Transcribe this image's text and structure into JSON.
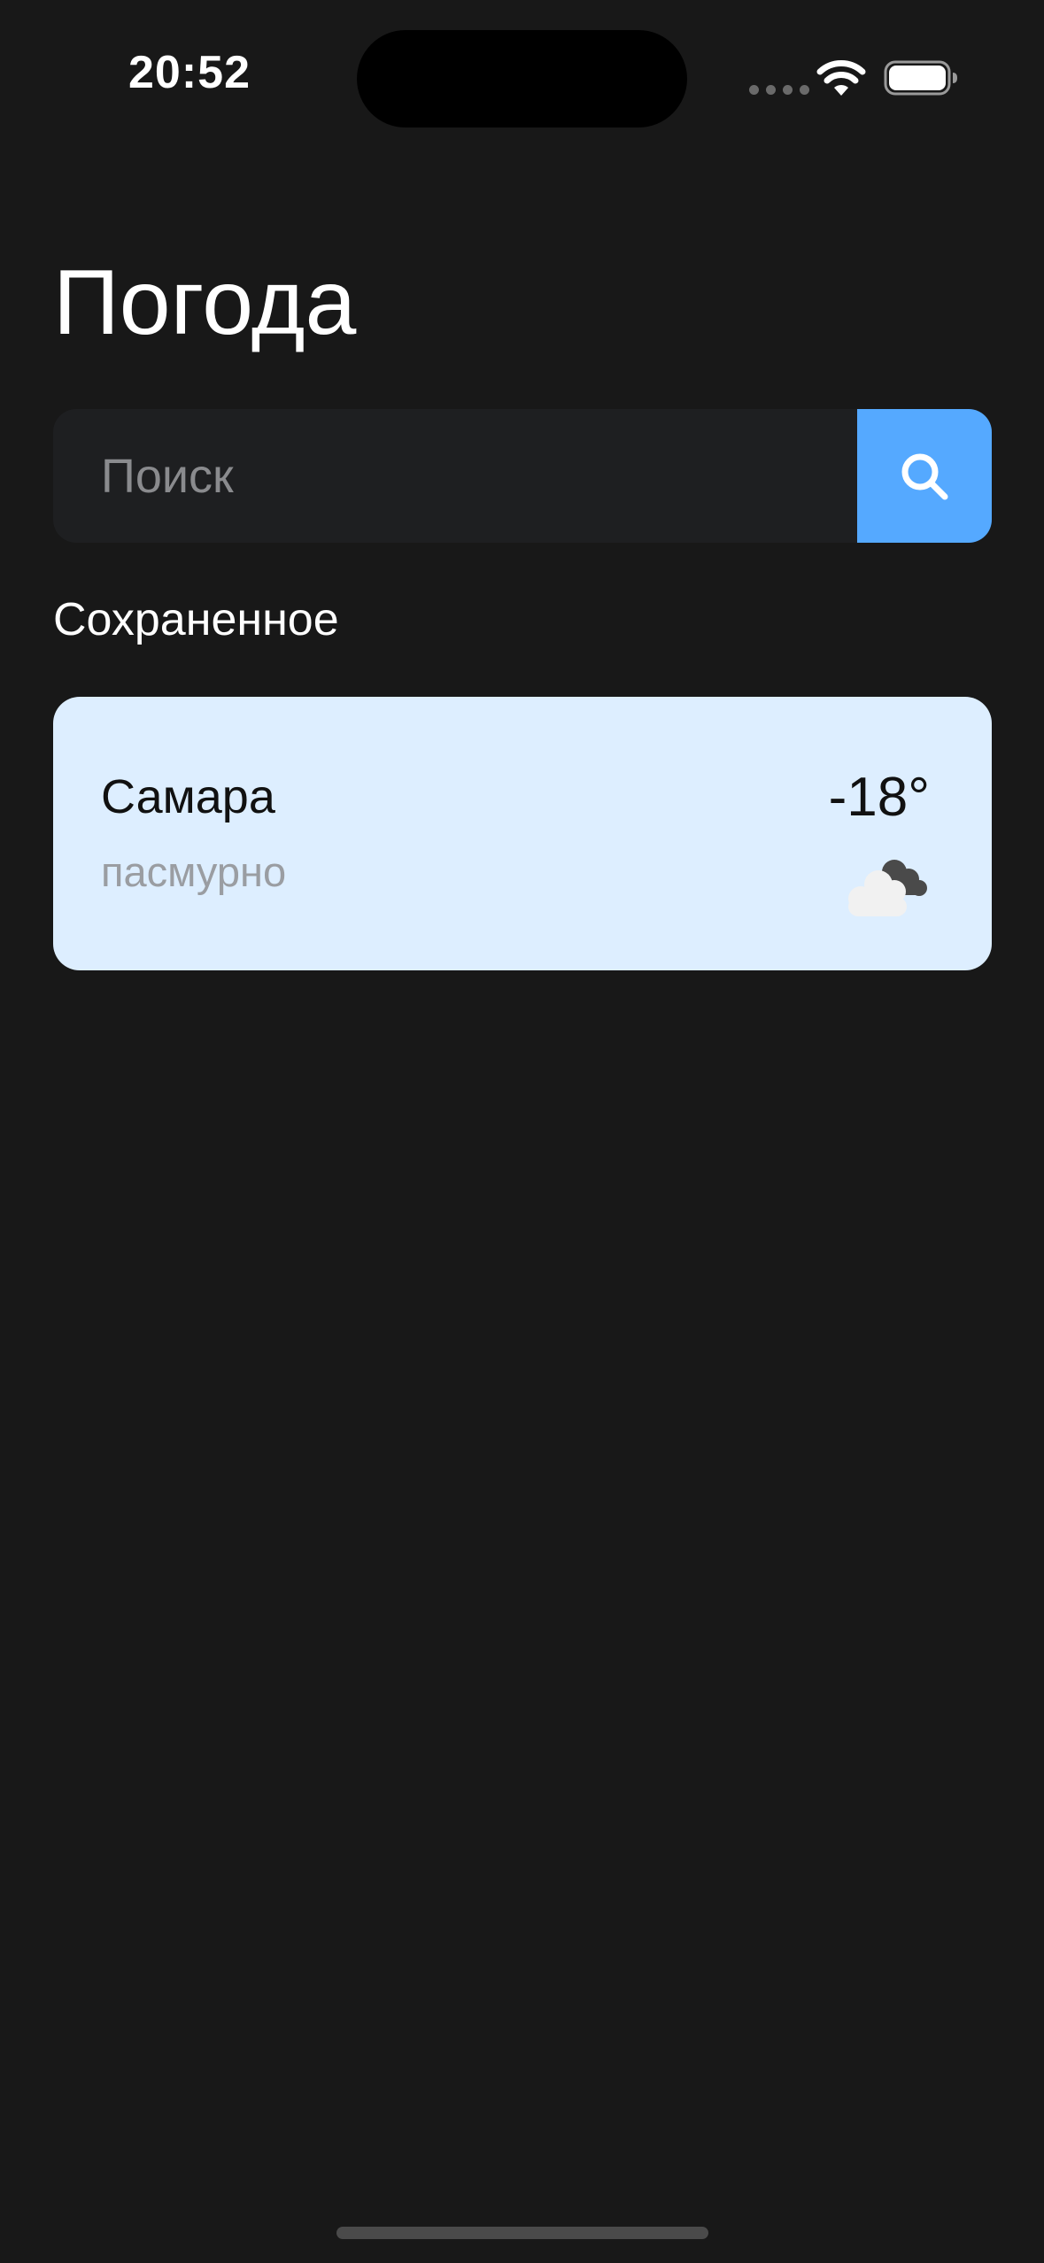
{
  "status_bar": {
    "time": "20:52"
  },
  "page": {
    "title": "Погода"
  },
  "search": {
    "placeholder": "Поиск",
    "button_icon": "search-icon"
  },
  "saved": {
    "section_title": "Сохраненное",
    "items": [
      {
        "city": "Самара",
        "condition": "пасмурно",
        "temperature": "-18°",
        "icon": "cloudy-icon"
      }
    ]
  },
  "colors": {
    "background": "#181818",
    "accent": "#55a9ff",
    "card_background": "#ddeeff",
    "search_background": "#1e1f21"
  }
}
